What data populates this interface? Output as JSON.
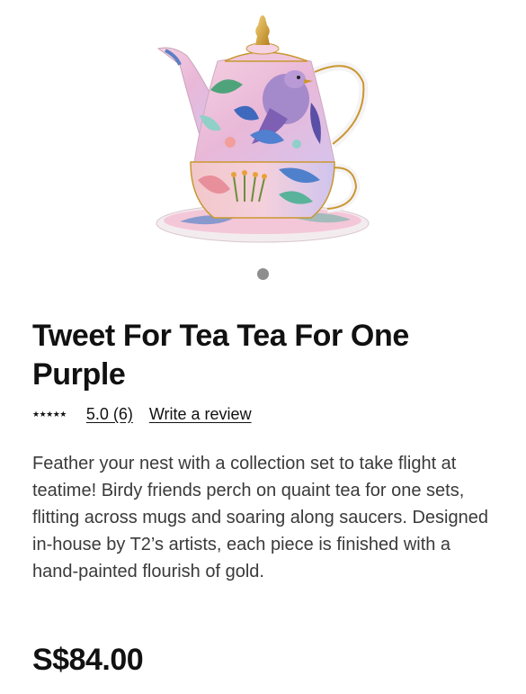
{
  "product": {
    "image_alt": "Tweet For Tea Tea For One Purple teapot",
    "title": "Tweet For Tea Tea For One Purple",
    "rating": {
      "stars": "★★★★★",
      "score_count": "5.0 (6)",
      "write_review": "Write a review"
    },
    "description": "Feather your nest with a collection set to take flight at teatime! Birdy friends perch on quaint tea for one sets, flitting across mugs and soaring along saucers. Designed in-house by T2’s artists, each piece is finished with a hand-painted flourish of gold.",
    "price": "S$84.00"
  },
  "carousel": {
    "current": 1,
    "total": 1
  },
  "colors": {
    "text": "#111111",
    "body_text": "#3a3a3a",
    "pager_dot": "#8e8e8e",
    "gold": "#c9972f",
    "pink": "#f2c9d4",
    "lilac": "#b79fd3",
    "blue": "#4a73c4"
  }
}
